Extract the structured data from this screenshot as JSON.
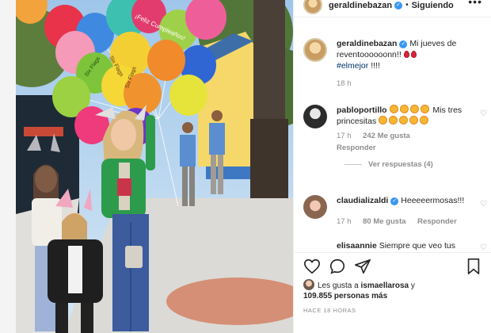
{
  "header": {
    "username": "geraldinebazan",
    "separator": "•",
    "follow_label": "Siguiendo",
    "more_label": "•••"
  },
  "caption": {
    "username": "geraldinebazan",
    "text": "Mi jueves de reventoooooonn!!",
    "hashtag": "#elmejor",
    "suffix": "!!!!",
    "time": "18 h"
  },
  "comments": [
    {
      "username": "pabloportillo",
      "text_end": "Mis tres princesitas",
      "time": "17 h",
      "likes": "242 Me gusta",
      "reply_label": "Responder",
      "view_replies": "Ver respuestas (4)"
    },
    {
      "username": "claudializaldi",
      "text": "Heeeeermosas!!!",
      "time": "17 h",
      "likes": "80 Me gusta",
      "reply_label": "Responder"
    },
    {
      "username": "elisaannie",
      "text": "Siempre que veo tus"
    }
  ],
  "likes_line": {
    "prefix": "Les gusta a",
    "user": "ismaellarosa",
    "joiner": "y",
    "count": "109.855 personas más"
  },
  "posted_ago": "HACE 18 HORAS",
  "icons": {
    "like": "heart-icon",
    "comment": "comment-icon",
    "share": "share-icon",
    "save": "bookmark-icon"
  },
  "photo": {
    "balloon_prints": [
      "¡Feliz Cumpleaños!",
      "Six Flags",
      "Six Flags",
      "Six Flags"
    ]
  },
  "colors": {
    "verified": "#3897f0",
    "hashtag": "#003569",
    "muted": "#8e8e8e"
  }
}
